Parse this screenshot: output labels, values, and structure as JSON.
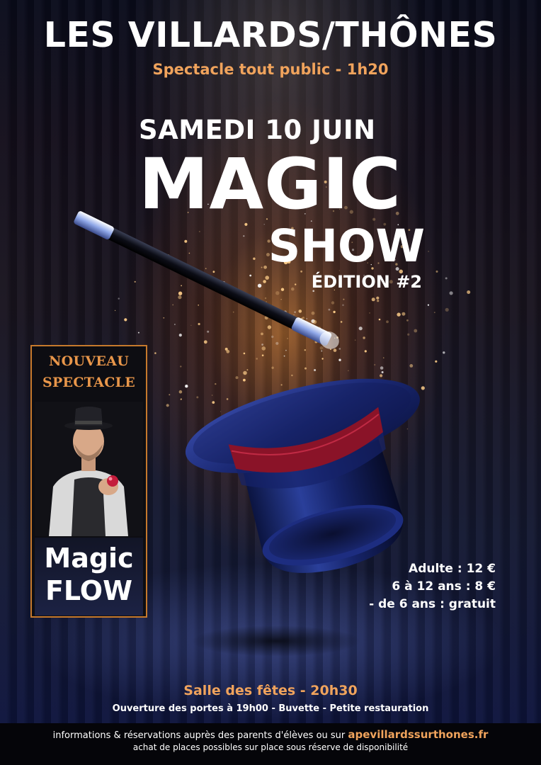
{
  "poster": {
    "venue": "LES VILLARDS/THÔNES",
    "subtitle": "Spectacle tout public - 1h20",
    "date": "SAMEDI 10 JUIN",
    "title_line1": "MAGIC",
    "title_line2": "SHOW",
    "edition": "ÉDITION #2"
  },
  "card": {
    "line1": "NOUVEAU",
    "line2": "SPECTACLE",
    "name_line1": "Magic",
    "name_line2": "FLOW"
  },
  "prices": [
    "Adulte : 12 €",
    "6 à 12 ans : 8 €",
    "- de 6 ans : gratuit"
  ],
  "event": {
    "place_time": "Salle des fêtes - 20h30",
    "details": "Ouverture des portes à 19h00 - Buvette - Petite restauration"
  },
  "footer": {
    "info_text": "informations & réservations auprès des parents d'élèves ou sur ",
    "info_link": "apevillardssurthones.fr",
    "note": "achat de places possibles sur place sous réserve de disponibilité"
  },
  "colors": {
    "accent_orange": "#f0a35c",
    "background": "#0b0f22",
    "card_border": "#c6792c"
  }
}
